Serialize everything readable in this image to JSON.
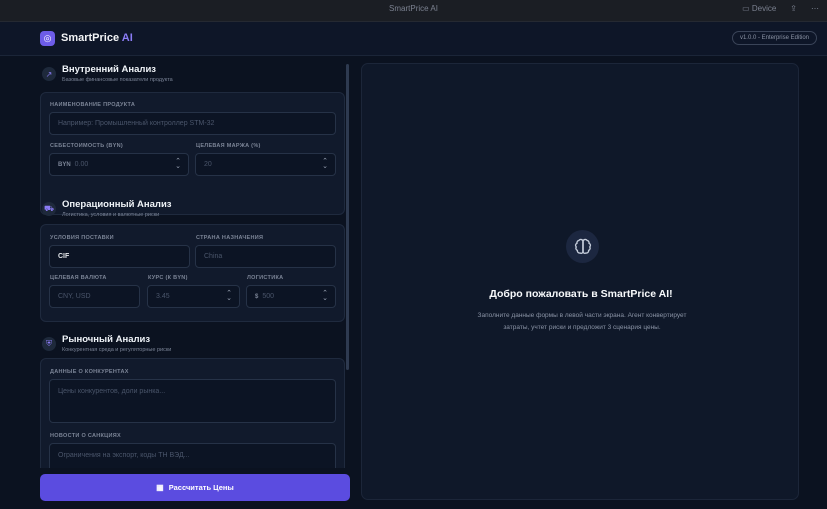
{
  "os_bar": {
    "title": "SmartPrice AI",
    "device": "Device"
  },
  "header": {
    "brand": "SmartPrice",
    "brand_ai": "AI",
    "version": "v1.0.0 - Enterprise Edition"
  },
  "sections": {
    "internal": {
      "title": "Внутренний Анализ",
      "subtitle": "Базовые финансовые показатели продукта",
      "product_label": "НАИМЕНОВАНИЕ ПРОДУКТА",
      "product_placeholder": "Например: Промышленный контроллер STM-32",
      "cost_label": "СЕБЕСТОИМОСТЬ (BYN)",
      "cost_prefix": "BYN",
      "cost_placeholder": "0.00",
      "margin_label": "ЦЕЛЕВАЯ МАРЖА (%)",
      "margin_placeholder": "20"
    },
    "operational": {
      "title": "Операционный Анализ",
      "subtitle": "Логистика, условия и валютные риски",
      "delivery_label": "УСЛОВИЯ ПОСТАВКИ",
      "delivery_value": "CIF",
      "country_label": "СТРАНА НАЗНАЧЕНИЯ",
      "country_placeholder": "China",
      "currency_label": "ЦЕЛЕВАЯ ВАЛЮТА",
      "currency_placeholder": "CNY, USD",
      "rate_label": "КУРС (К BYN)",
      "rate_placeholder": "3.45",
      "logistics_label": "ЛОГИСТИКА",
      "logistics_prefix": "$",
      "logistics_placeholder": "500"
    },
    "market": {
      "title": "Рыночный Анализ",
      "subtitle": "Конкурентная среда и регуляторные риски",
      "competitors_label": "ДАННЫЕ О КОНКУРЕНТАХ",
      "competitors_placeholder": "Цены конкурентов, доли рынка...",
      "sanctions_label": "НОВОСТИ О САНКЦИЯХ",
      "sanctions_placeholder": "Ограничения на экспорт, коды ТН ВЭД..."
    }
  },
  "calc_button": "Рассчитать Цены",
  "welcome": {
    "title": "Добро пожаловать в SmartPrice AI!",
    "text": "Заполните данные формы в левой части экрана. Агент конвертирует затраты, учтет риски и предложит 3 сценария цены."
  },
  "colors": {
    "accent": "#5b4ce0",
    "background": "#0b1220",
    "panel": "#0f1829"
  }
}
